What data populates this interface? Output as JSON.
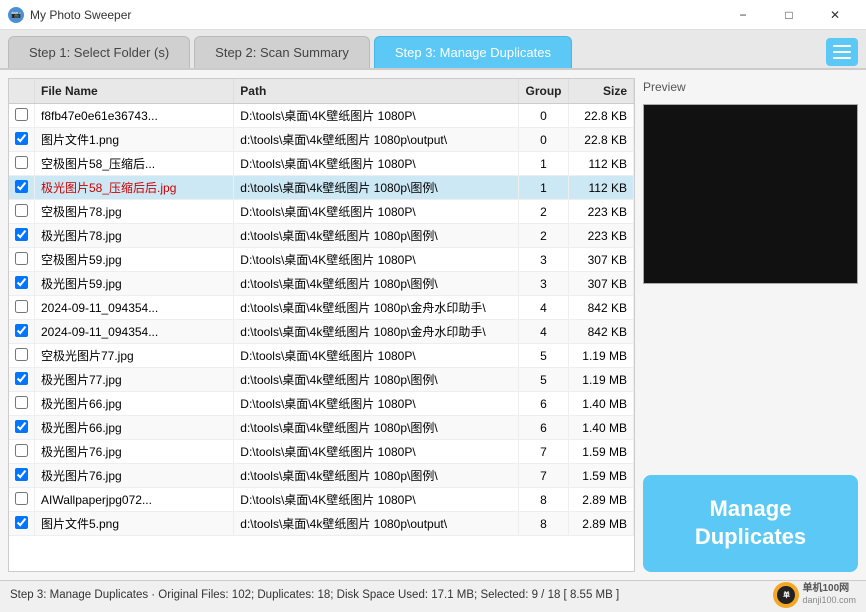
{
  "titleBar": {
    "icon": "📷",
    "title": "My Photo Sweeper",
    "minimize": "−",
    "maximize": "□",
    "close": "✕"
  },
  "tabs": [
    {
      "id": "step1",
      "label": "Step 1: Select Folder (s)",
      "active": false
    },
    {
      "id": "step2",
      "label": "Step 2: Scan Summary",
      "active": false
    },
    {
      "id": "step3",
      "label": "Step 3: Manage Duplicates",
      "active": true
    }
  ],
  "table": {
    "headers": [
      "",
      "File Name",
      "Path",
      "Group",
      "Size"
    ],
    "rows": [
      {
        "checked": false,
        "name": "f8fb47e0e61e36743...",
        "path": "D:\\tools\\桌面\\4K壁纸图片 1080P\\",
        "group": "0",
        "size": "22.8 KB",
        "style": ""
      },
      {
        "checked": true,
        "name": "图片文件1.png",
        "path": "d:\\tools\\桌面\\4k壁纸图片 1080p\\output\\",
        "group": "0",
        "size": "22.8 KB",
        "style": ""
      },
      {
        "checked": false,
        "name": "空极图片58_压缩后...",
        "path": "D:\\tools\\桌面\\4K壁纸图片 1080P\\",
        "group": "1",
        "size": "112 KB",
        "style": ""
      },
      {
        "checked": true,
        "name": "极光图片58_压缩后后.jpg",
        "path": "d:\\tools\\桌面\\4k壁纸图片 1080p\\图例\\",
        "group": "1",
        "size": "112 KB",
        "style": "selected red"
      },
      {
        "checked": false,
        "name": "空极图片78.jpg",
        "path": "D:\\tools\\桌面\\4K壁纸图片 1080P\\",
        "group": "2",
        "size": "223 KB",
        "style": ""
      },
      {
        "checked": true,
        "name": "极光图片78.jpg",
        "path": "d:\\tools\\桌面\\4k壁纸图片 1080p\\图例\\",
        "group": "2",
        "size": "223 KB",
        "style": ""
      },
      {
        "checked": false,
        "name": "空极图片59.jpg",
        "path": "D:\\tools\\桌面\\4K壁纸图片 1080P\\",
        "group": "3",
        "size": "307 KB",
        "style": ""
      },
      {
        "checked": true,
        "name": "极光图片59.jpg",
        "path": "d:\\tools\\桌面\\4k壁纸图片 1080p\\图例\\",
        "group": "3",
        "size": "307 KB",
        "style": ""
      },
      {
        "checked": false,
        "name": "2024-09-11_094354...",
        "path": "d:\\tools\\桌面\\4k壁纸图片 1080p\\金舟水印助手\\",
        "group": "4",
        "size": "842 KB",
        "style": ""
      },
      {
        "checked": true,
        "name": "2024-09-11_094354...",
        "path": "d:\\tools\\桌面\\4k壁纸图片 1080p\\金舟水印助手\\",
        "group": "4",
        "size": "842 KB",
        "style": ""
      },
      {
        "checked": false,
        "name": "空极光图片77.jpg",
        "path": "D:\\tools\\桌面\\4K壁纸图片 1080P\\",
        "group": "5",
        "size": "1.19 MB",
        "style": ""
      },
      {
        "checked": true,
        "name": "极光图片77.jpg",
        "path": "d:\\tools\\桌面\\4k壁纸图片 1080p\\图例\\",
        "group": "5",
        "size": "1.19 MB",
        "style": ""
      },
      {
        "checked": false,
        "name": "极光图片66.jpg",
        "path": "D:\\tools\\桌面\\4K壁纸图片 1080P\\",
        "group": "6",
        "size": "1.40 MB",
        "style": ""
      },
      {
        "checked": true,
        "name": "极光图片66.jpg",
        "path": "d:\\tools\\桌面\\4k壁纸图片 1080p\\图例\\",
        "group": "6",
        "size": "1.40 MB",
        "style": ""
      },
      {
        "checked": false,
        "name": "极光图片76.jpg",
        "path": "D:\\tools\\桌面\\4K壁纸图片 1080P\\",
        "group": "7",
        "size": "1.59 MB",
        "style": ""
      },
      {
        "checked": true,
        "name": "极光图片76.jpg",
        "path": "d:\\tools\\桌面\\4k壁纸图片 1080p\\图例\\",
        "group": "7",
        "size": "1.59 MB",
        "style": ""
      },
      {
        "checked": false,
        "name": "AIWallpaperjpg072...",
        "path": "D:\\tools\\桌面\\4K壁纸图片 1080P\\",
        "group": "8",
        "size": "2.89 MB",
        "style": ""
      },
      {
        "checked": true,
        "name": "图片文件5.png",
        "path": "d:\\tools\\桌面\\4k壁纸图片 1080p\\output\\",
        "group": "8",
        "size": "2.89 MB",
        "style": ""
      }
    ]
  },
  "preview": {
    "label": "Preview",
    "imageAlt": "Preview area - black"
  },
  "manageBtn": {
    "line1": "Manage",
    "line2": "Duplicates"
  },
  "statusBar": {
    "text": "Step 3: Manage Duplicates  ·  Original Files: 102;   Duplicates: 18;   Disk Space Used: 17.1 MB;   Selected: 9 / 18  [ 8.55 MB ]",
    "logoText": "单机100网",
    "siteUrl": "danji100.com"
  }
}
